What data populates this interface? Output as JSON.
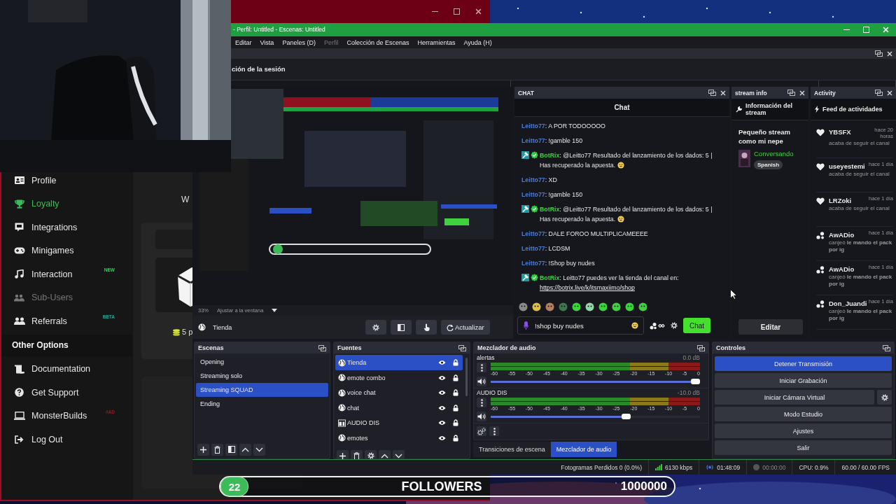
{
  "browser": {
    "sidebar": [
      {
        "kind": "item",
        "label": "Profile",
        "selected": false,
        "disabled": false
      },
      {
        "kind": "item",
        "label": "Loyalty",
        "selected": true,
        "disabled": false
      },
      {
        "kind": "item",
        "label": "Integrations",
        "selected": false,
        "disabled": false
      },
      {
        "kind": "item",
        "label": "Minigames",
        "selected": false,
        "disabled": false
      },
      {
        "kind": "item",
        "label": "Interaction",
        "selected": false,
        "disabled": false,
        "badge": {
          "text": "NEW",
          "color": "#27d35a"
        }
      },
      {
        "kind": "item",
        "label": "Sub-Users",
        "selected": false,
        "disabled": true
      },
      {
        "kind": "item",
        "label": "Referrals",
        "selected": false,
        "disabled": false,
        "badge": {
          "text": "BETA",
          "color": "#1fa89a"
        }
      },
      {
        "kind": "header",
        "label": "Other Options"
      },
      {
        "kind": "item",
        "label": "Documentation",
        "selected": false,
        "disabled": false
      },
      {
        "kind": "item",
        "label": "Get Support",
        "selected": false,
        "disabled": false
      },
      {
        "kind": "item",
        "label": "MonsterBuilds",
        "selected": false,
        "disabled": false,
        "badge": {
          "text": "#AD",
          "color": "#a0132e"
        }
      },
      {
        "kind": "item",
        "label": "Log Out",
        "selected": false,
        "disabled": false
      }
    ],
    "content": {
      "heading": "W",
      "points": "5 p"
    }
  },
  "obs": {
    "title": "- Perfil: Untitled - Escenas: Untitled",
    "menu": [
      {
        "label": "Editar",
        "disabled": false
      },
      {
        "label": "Vista",
        "disabled": false
      },
      {
        "label": "Paneles (D)",
        "disabled": false
      },
      {
        "label": "Perfil",
        "disabled": true
      },
      {
        "label": "Colección de Escenas",
        "disabled": false
      },
      {
        "label": "Herramientas",
        "disabled": false
      },
      {
        "label": "Ayuda (H)",
        "disabled": false
      }
    ],
    "session_dock": {
      "title": "ción de la sesión"
    },
    "zoom": "33%",
    "fit": "Ajustar a la ventana",
    "source_toolbar": {
      "source": "Tienda",
      "refresh": "Actualizar"
    },
    "chat": {
      "tab": "CHAT",
      "header": "Chat",
      "messages": [
        {
          "kind": "user",
          "user": "Leitto77",
          "text": ": A POR TODOOOOO"
        },
        {
          "kind": "user",
          "user": "Leitto77",
          "text": ": !gamble 150"
        },
        {
          "kind": "bot",
          "user": "BotRix",
          "text": ": @Leitto77 Resultado del lanzamiento de los dados: 5 | Has recuperado la apuesta.",
          "emoji": true
        },
        {
          "kind": "user",
          "user": "Leitto77",
          "text": ": XD"
        },
        {
          "kind": "user",
          "user": "Leitto77",
          "text": ": !gamble 150"
        },
        {
          "kind": "bot",
          "user": "BotRix",
          "text": ": @Leitto77 Resultado del lanzamiento de los dados: 5 | Has recuperado la apuesta.",
          "emoji": true
        },
        {
          "kind": "user",
          "user": "Leitto77",
          "text": ": DALE FOROO MULTIPLICAMEEEE"
        },
        {
          "kind": "user",
          "user": "Leitto77",
          "text": ": LCDSM"
        },
        {
          "kind": "user",
          "user": "Leitto77",
          "text": ": !Shop buy nudes"
        },
        {
          "kind": "bot",
          "user": "BotRix",
          "text": ": Leitto77 puedes ver la tienda del canal en:",
          "link": "https://botrix.live/k/itsmaxiimo/shop"
        }
      ],
      "input": {
        "value": "!shop buy nudes"
      },
      "send": "Chat"
    },
    "stream_info": {
      "tab": "stream info",
      "header": "Información del stream",
      "title": "Pequeño stream como mi nepe",
      "category": "Conversando",
      "tag": "Spanish",
      "edit": "Editar"
    },
    "activity": {
      "tab": "Activity",
      "header": "Feed de actividades",
      "items": [
        {
          "kind": "follow",
          "user": "YBSFX",
          "time": "hace 20 horas",
          "text": "acaba de seguir el canal"
        },
        {
          "kind": "follow",
          "user": "useyestemi",
          "time": "hace 1 día",
          "text": "acaba de seguir el canal"
        },
        {
          "kind": "follow",
          "user": "LRZoki",
          "time": "hace 1 día",
          "text": "acaba de seguir el canal"
        },
        {
          "kind": "redeem",
          "user": "AwADio",
          "time": "hace 1 día",
          "text": "canjeó **le mando el pack por ig**"
        },
        {
          "kind": "redeem",
          "user": "AwADio",
          "time": "hace 1 día",
          "text": "canjeó **le mando el pack por ig**"
        },
        {
          "kind": "redeem",
          "user": "Don_Juandi",
          "time": "hace 1 día",
          "text": "canjeó **le mando el pack por ig**"
        }
      ]
    },
    "scenes": {
      "title": "Escenas",
      "items": [
        {
          "label": "Opening",
          "selected": false
        },
        {
          "label": "Streaming solo",
          "selected": false
        },
        {
          "label": "Streaming SQUAD",
          "selected": true
        },
        {
          "label": "Ending",
          "selected": false
        }
      ]
    },
    "sources": {
      "title": "Fuentes",
      "items": [
        {
          "kind": "browser",
          "label": "Tienda",
          "selected": true
        },
        {
          "kind": "browser",
          "label": "emote combo",
          "selected": false
        },
        {
          "kind": "browser",
          "label": "voice chat",
          "selected": false
        },
        {
          "kind": "browser",
          "label": "chat",
          "selected": false
        },
        {
          "kind": "window",
          "label": "AUDIO DIS",
          "selected": false
        },
        {
          "kind": "browser",
          "label": "emotes",
          "selected": false
        }
      ]
    },
    "mixer": {
      "title": "Mezclador de audio",
      "channels": [
        {
          "name": "alertas",
          "reading": "0.0 dB",
          "level": 1.0,
          "ticks": [
            "-60",
            "-55",
            "-50",
            "-45",
            "-40",
            "-35",
            "-30",
            "-25",
            "-20",
            "-15",
            "-10",
            "-5",
            "0"
          ]
        },
        {
          "name": "AUDIO DIS",
          "reading": "-10.0 dB",
          "level": 0.67,
          "ticks": [
            "-60",
            "-55",
            "-50",
            "-45",
            "-40",
            "-35",
            "-30",
            "-25",
            "-20",
            "-15",
            "-10",
            "-5",
            "0"
          ]
        }
      ]
    },
    "dock_tabs": [
      {
        "label": "Transiciones de escena",
        "selected": false
      },
      {
        "label": "Mezclador de audio",
        "selected": true
      }
    ],
    "controls": {
      "title": "Controles",
      "buttons": [
        {
          "label": "Detener Transmisión",
          "active": true
        },
        {
          "label": "Iniciar Grabación",
          "active": false
        },
        {
          "label": "Iniciar Cámara Virtual",
          "active": false,
          "settings": true
        },
        {
          "label": "Modo Estudio",
          "active": false
        },
        {
          "label": "Ajustes",
          "active": false
        },
        {
          "label": "Salir",
          "active": false
        }
      ]
    },
    "status_bar": {
      "dropped": "Fotogramas Perdidos 0 (0.0%)",
      "bitrate": "6130 kbps",
      "stream_time": "01:48:09",
      "rec_time": "00:00:00",
      "cpu": "CPU: 0.9%",
      "fps": "60.00 / 60.00 FPS"
    }
  },
  "followers": {
    "count": "22",
    "label": "FOLLOWERS",
    "goal": "1000000"
  }
}
